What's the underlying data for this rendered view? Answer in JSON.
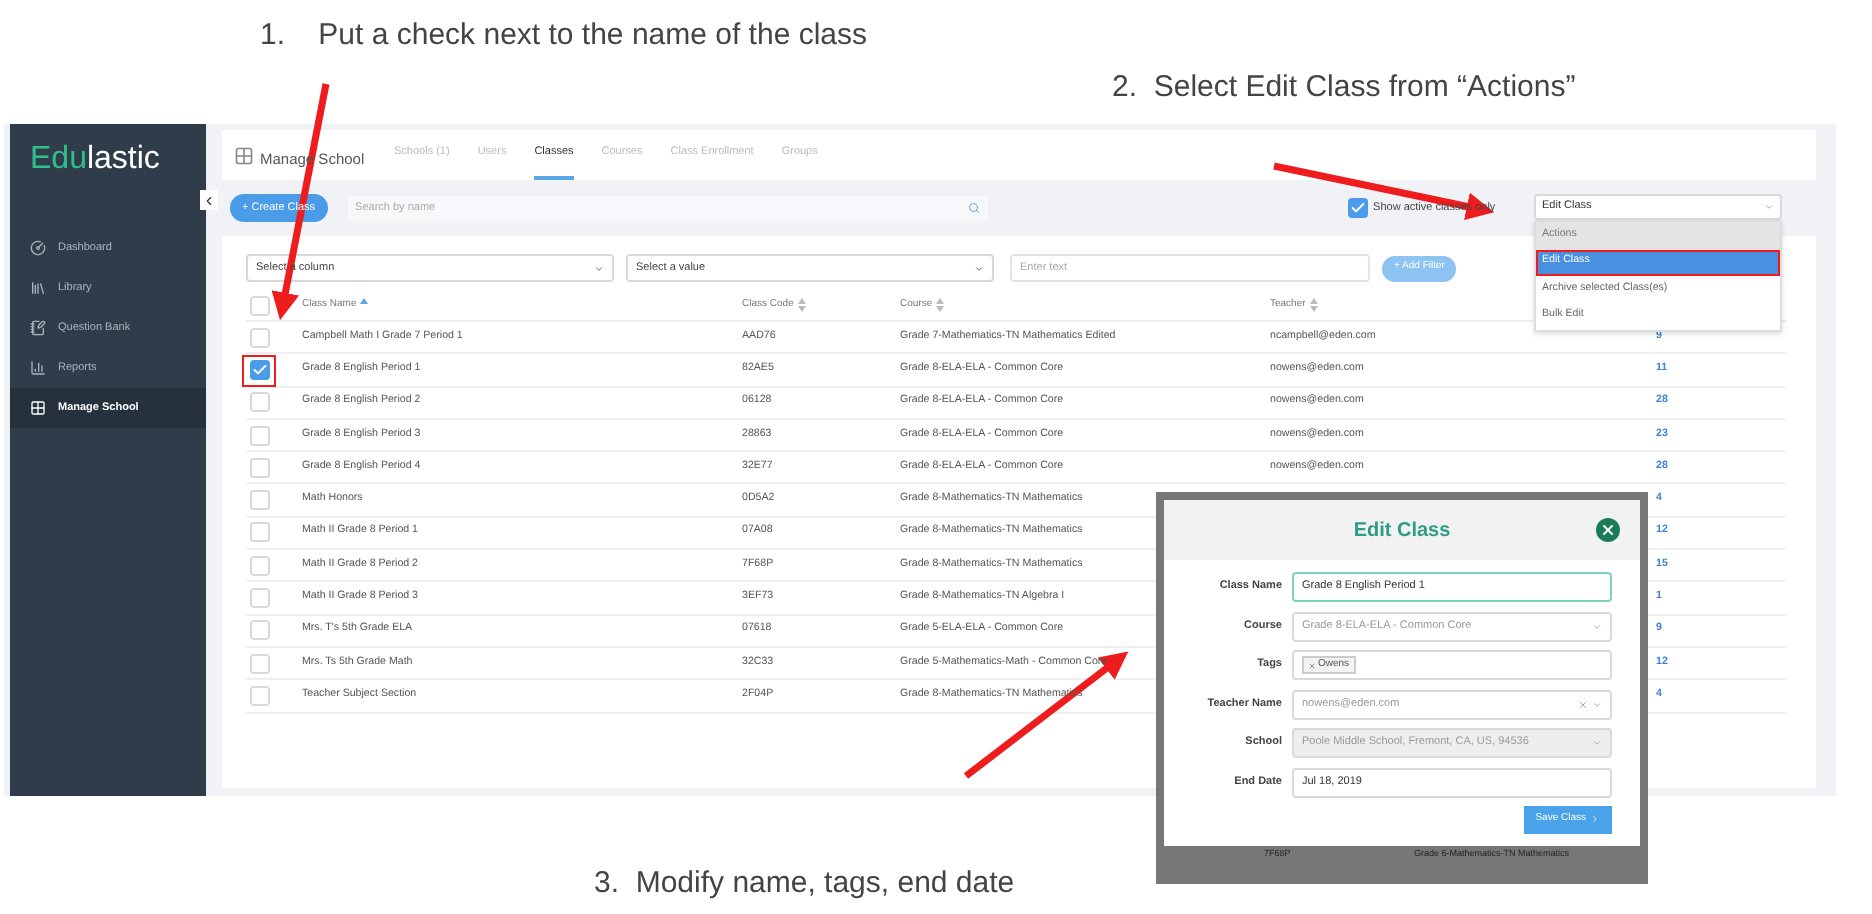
{
  "instructions": [
    {
      "number": "1.",
      "text": "Put a check next to the name of the class"
    },
    {
      "number": "2.",
      "text": "Select Edit Class from “Actions”"
    },
    {
      "number": "3.",
      "text": "Modify name, tags, end date"
    }
  ],
  "sidebar": {
    "logo": {
      "accent": "Edu",
      "rest": "lastic"
    },
    "items": [
      {
        "kind": "dashboard",
        "label": "Dashboard",
        "selected": false
      },
      {
        "kind": "library",
        "label": "Library",
        "selected": false
      },
      {
        "kind": "questions",
        "label": "Question Bank",
        "selected": false
      },
      {
        "kind": "reports",
        "label": "Reports",
        "selected": false
      },
      {
        "kind": "school",
        "label": "Manage School",
        "selected": true
      }
    ]
  },
  "header": {
    "title": "Manage School",
    "tabs": [
      {
        "label": "Schools (1)",
        "selected": false
      },
      {
        "label": "Users",
        "selected": false
      },
      {
        "label": "Classes",
        "selected": true
      },
      {
        "label": "Courses",
        "selected": false
      },
      {
        "label": "Class Enrollment",
        "selected": false
      },
      {
        "label": "Groups",
        "selected": false
      }
    ]
  },
  "toolbar": {
    "create_button": "+ Create Class",
    "search": {
      "placeholder": "Search by name"
    },
    "active_only": {
      "label": "Show active classes only",
      "checked": true
    },
    "actions": {
      "value": "Edit Class",
      "options": [
        {
          "kind": "header",
          "label": "Actions",
          "selected": false
        },
        {
          "kind": "option",
          "label": "Edit Class",
          "selected": true
        },
        {
          "kind": "option",
          "label": "Archive selected Class(es)",
          "selected": false
        },
        {
          "kind": "option",
          "label": "Bulk Edit",
          "selected": false
        }
      ]
    }
  },
  "filters": {
    "column_select": {
      "placeholder": "Select a column"
    },
    "value_select": {
      "placeholder": "Select a value"
    },
    "text": {
      "placeholder": "Enter text"
    },
    "add_button": "+ Add Filter"
  },
  "table": {
    "all_checked": false,
    "columns": [
      {
        "label": "Class Name",
        "sorted": true
      },
      {
        "label": "Class Code",
        "sorted": false
      },
      {
        "label": "Course",
        "sorted": false
      },
      {
        "label": "Teacher",
        "sorted": false
      }
    ],
    "rows": [
      {
        "checked": false,
        "name": "Campbell Math I Grade 7 Period 1",
        "code": "AAD76",
        "course": "Grade 7-Mathematics-TN Mathematics Edited",
        "teacher": "ncampbell@eden.com",
        "count": "9"
      },
      {
        "checked": true,
        "name": "Grade 8 English Period 1",
        "code": "82AE5",
        "course": "Grade 8-ELA-ELA - Common Core",
        "teacher": "nowens@eden.com",
        "count": "11"
      },
      {
        "checked": false,
        "name": "Grade 8 English Period 2",
        "code": "06128",
        "course": "Grade 8-ELA-ELA - Common Core",
        "teacher": "nowens@eden.com",
        "count": "28"
      },
      {
        "checked": false,
        "name": "Grade 8 English Period 3",
        "code": "28863",
        "course": "Grade 8-ELA-ELA - Common Core",
        "teacher": "nowens@eden.com",
        "count": "23"
      },
      {
        "checked": false,
        "name": "Grade 8 English Period 4",
        "code": "32E77",
        "course": "Grade 8-ELA-ELA - Common Core",
        "teacher": "nowens@eden.com",
        "count": "28"
      },
      {
        "checked": false,
        "name": "Math Honors",
        "code": "0D5A2",
        "course": "Grade 8-Mathematics-TN Mathematics",
        "count": "4"
      },
      {
        "checked": false,
        "name": "Math II Grade 8 Period 1",
        "code": "07A08",
        "course": "Grade 8-Mathematics-TN Mathematics",
        "count": "12"
      },
      {
        "checked": false,
        "name": "Math II Grade 8 Period 2",
        "code": "7F68P",
        "course": "Grade 8-Mathematics-TN Mathematics",
        "count": "15"
      },
      {
        "checked": false,
        "name": "Math II Grade 8 Period 3",
        "code": "3EF73",
        "course": "Grade 8-Mathematics-TN Algebra I",
        "count": "1"
      },
      {
        "checked": false,
        "name": "Mrs. T's 5th Grade ELA",
        "code": "07618",
        "course": "Grade 5-ELA-ELA - Common Core",
        "count": "9"
      },
      {
        "checked": false,
        "name": "Mrs. Ts 5th Grade Math",
        "code": "32C33",
        "course": "Grade 5-Mathematics-Math - Common Core",
        "count": "12"
      },
      {
        "checked": false,
        "name": "Teacher Subject Section",
        "code": "2F04P",
        "course": "Grade 8-Mathematics-TN Mathematics",
        "count": "4"
      }
    ]
  },
  "dialog": {
    "title": "Edit Class",
    "fields": [
      {
        "kind": "input",
        "label": "Class Name",
        "value": "Grade 8 English Period 1"
      },
      {
        "kind": "select",
        "label": "Course",
        "value": "Grade 8-ELA-ELA - Common Core"
      },
      {
        "kind": "tags",
        "label": "Tags",
        "tags": [
          "Owens"
        ]
      },
      {
        "kind": "multiselect",
        "label": "Teacher Name",
        "value": "nowens@eden.com"
      },
      {
        "kind": "disabled",
        "label": "School",
        "value": "Poole Middle School, Fremont, CA, US, 94536"
      },
      {
        "kind": "input",
        "label": "End Date",
        "value": "Jul 18, 2019"
      }
    ],
    "save_button": "Save Class",
    "backdrop_row": [
      "7F68P",
      "Grade 6-Mathematics-TN Mathematics"
    ]
  }
}
